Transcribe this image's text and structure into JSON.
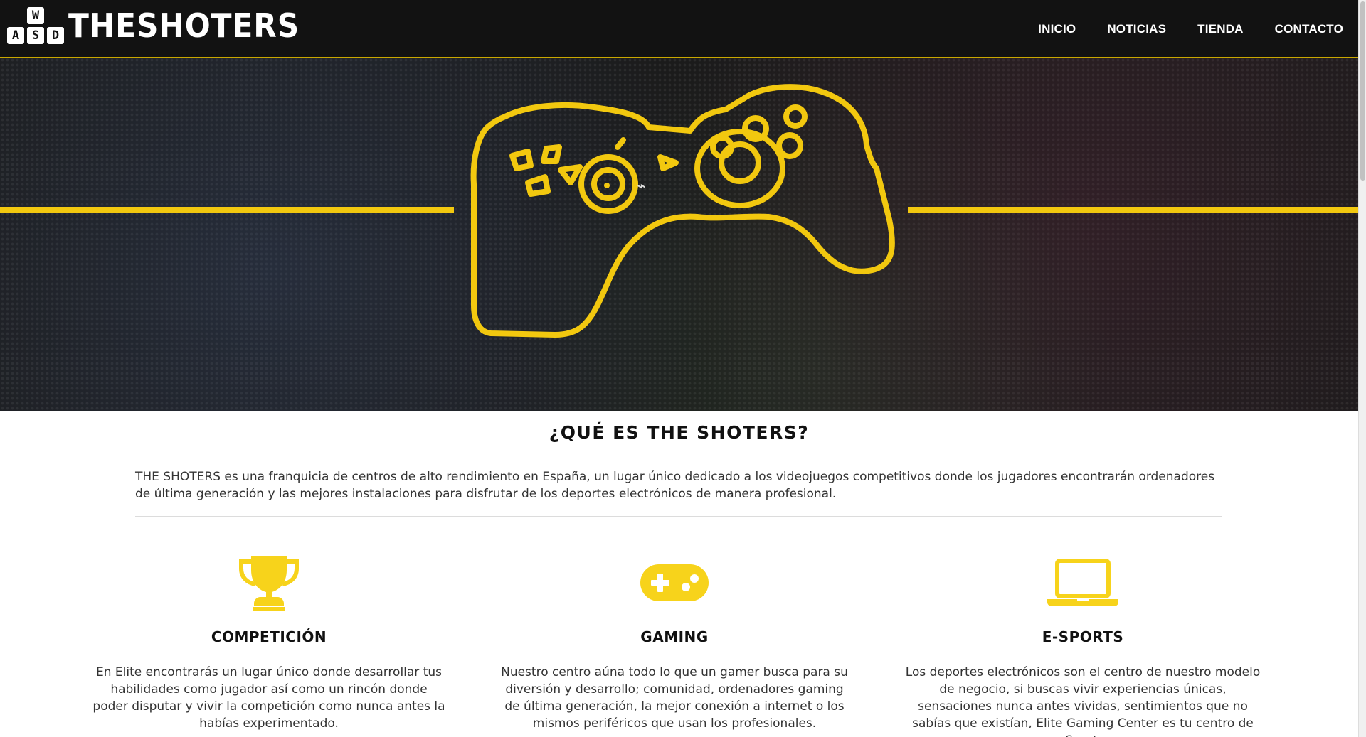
{
  "brand": {
    "logo_text": "THESHOTERS",
    "keys": [
      "W",
      "A",
      "S",
      "D"
    ]
  },
  "nav": {
    "items": [
      {
        "label": "INICIO"
      },
      {
        "label": "NOTICIAS"
      },
      {
        "label": "TIENDA"
      },
      {
        "label": "CONTACTO"
      }
    ]
  },
  "hero": {
    "accent_color": "#f2c80f",
    "icon": "gamepad-outline-icon"
  },
  "about": {
    "title": "¿QUÉ ES THE SHOTERS?",
    "text": "THE SHOTERS es una franquicia de centros de alto rendimiento en España, un lugar único dedicado a los videojuegos competitivos donde los jugadores encontrarán ordenadores de última generación y las mejores instalaciones para disfrutar de los deportes electrónicos de manera profesional."
  },
  "features": [
    {
      "icon": "trophy-icon",
      "title": "COMPETICIÓN",
      "text": "En Elite encontrarás un lugar único donde desarrollar tus habilidades como jugador así como un rincón donde poder disputar y vivir la competición como nunca antes la habías experimentado."
    },
    {
      "icon": "gamepad-icon",
      "title": "GAMING",
      "text": "Nuestro centro aúna todo lo que un gamer busca para su diversión y desarrollo; comunidad, ordenadores gaming de última generación, la mejor conexión a internet o los mismos periféricos que usan los profesionales."
    },
    {
      "icon": "laptop-icon",
      "title": "E-SPORTS",
      "text": "Los deportes electrónicos son el centro de nuestro modelo de negocio, si buscas vivir experiencias únicas, sensaciones nunca antes vividas, sentimientos que no sabías que existían, Elite Gaming Center es tu centro de eSports."
    }
  ],
  "colors": {
    "header_bg": "#121212",
    "accent": "#f2c80f",
    "icon_yellow": "#f7d31b"
  }
}
